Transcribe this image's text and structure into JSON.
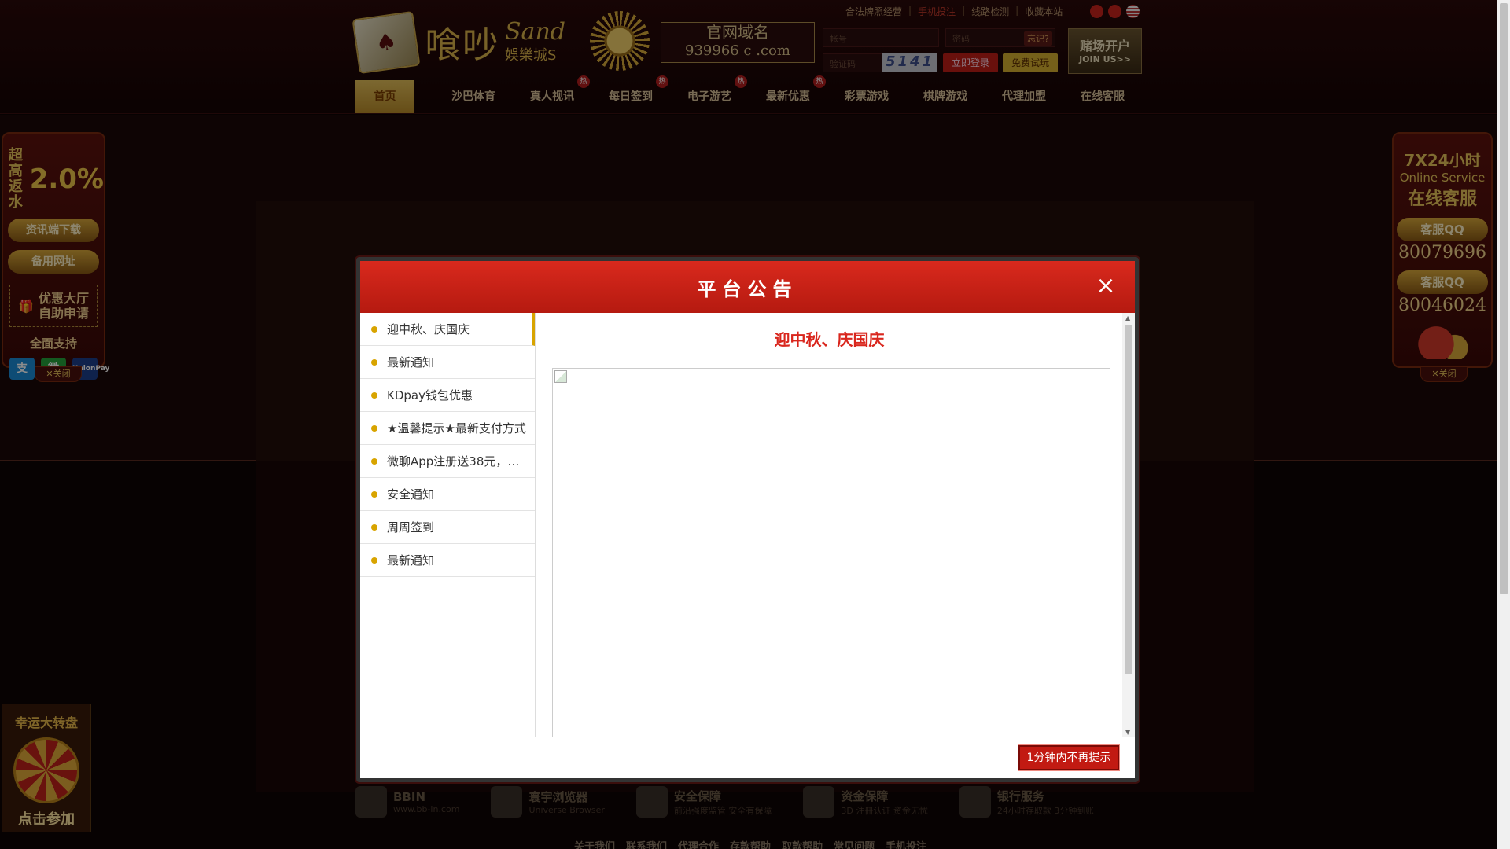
{
  "header": {
    "logo": {
      "mark": "♠",
      "name": "喰吵",
      "sand": "Sand",
      "sub": "娛樂城S"
    },
    "domain": {
      "title": "官网域名",
      "value": "939966 c .com"
    },
    "top_links": [
      "合法牌照经营",
      "手机投注",
      "线路检测",
      "收藏本站"
    ],
    "login": {
      "user_placeholder": "帐号",
      "pass_placeholder": "密码",
      "forgot": "忘记?",
      "code_placeholder": "验证码",
      "captcha": "5141",
      "login_btn": "立即登录",
      "trial_btn": "免费试玩"
    },
    "join": {
      "title": "赌场开户",
      "sub": "JOIN US>>"
    },
    "nav": [
      {
        "label": "首页",
        "hot": ""
      },
      {
        "label": "沙巴体育",
        "hot": ""
      },
      {
        "label": "真人视讯",
        "hot": "热"
      },
      {
        "label": "每日签到",
        "hot": "热"
      },
      {
        "label": "电子游艺",
        "hot": "热"
      },
      {
        "label": "最新优惠",
        "hot": "热"
      },
      {
        "label": "彩票游戏",
        "hot": ""
      },
      {
        "label": "棋牌游戏",
        "hot": ""
      },
      {
        "label": "代理加盟",
        "hot": ""
      },
      {
        "label": "在线客服",
        "hot": ""
      }
    ]
  },
  "side_left": {
    "rebate_label_1": "超高",
    "rebate_label_2": "返水",
    "rebate_value": "2.0%",
    "download": "资讯端下载",
    "backup": "备用网址",
    "promo_1": "优惠大厅",
    "promo_2": "自助申请",
    "support": "全面支持",
    "pay_ali": "支",
    "pay_wx": "微",
    "pay_up": "UnionPay",
    "close": "✕关闭"
  },
  "side_right": {
    "hours": "7X24小时",
    "online": "Online Service",
    "cs": "在线客服",
    "qq_label": "客服QQ",
    "qq1": "80079696",
    "qq2": "80046024",
    "close": "✕关闭"
  },
  "wheel": {
    "title": "幸运大转盘",
    "cta": "点击参加"
  },
  "footer": {
    "logos": [
      {
        "t1": "BBIN",
        "t2": "www.bb-in.com"
      },
      {
        "t1": "寰宇浏览器",
        "t2": "Universe Browser"
      },
      {
        "t1": "安全保障",
        "t2": "前沿强度监管 安全有保障"
      },
      {
        "t1": "资金保障",
        "t2": "3D 注冊认证 资金无忧"
      },
      {
        "t1": "银行服务",
        "t2": "24小时存取款 3分钟到账"
      }
    ],
    "links": [
      "关于我们",
      "联系我们",
      "代理合作",
      "存款帮助",
      "取款帮助",
      "常见问题",
      "手机投注"
    ]
  },
  "modal": {
    "title": "平台公告",
    "close_icon": "×",
    "items": [
      "迎中秋、庆国庆",
      "最新通知",
      "KDpay钱包优惠",
      "★温馨提示★最新支付方式",
      "微聊App注册送38元，…",
      "安全通知",
      "周周签到",
      "最新通知"
    ],
    "article_title": "迎中秋、庆国庆",
    "dismiss": "1分钟内不再提示"
  },
  "colors": {
    "accent": "#d9261d",
    "gold": "#d8a400",
    "header_red": "#c21a12"
  }
}
